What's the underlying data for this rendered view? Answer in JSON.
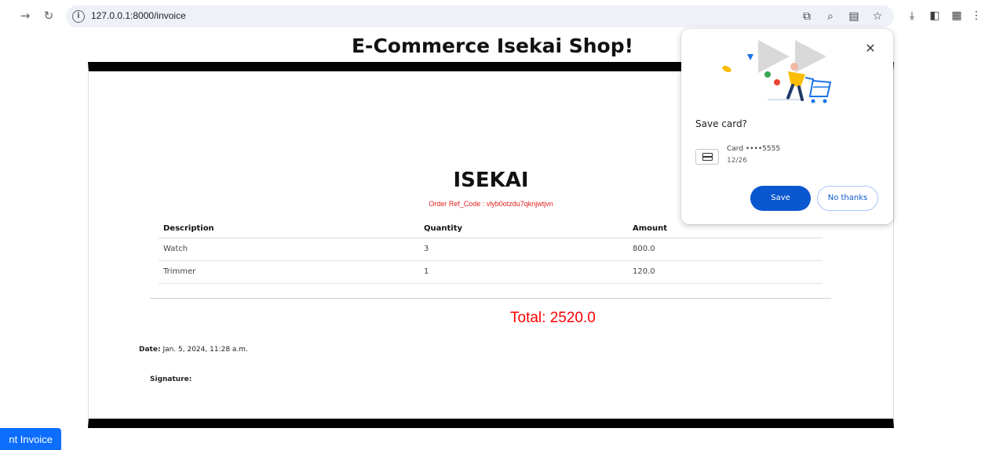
{
  "browser": {
    "url": "127.0.0.1:8000/invoice",
    "icons": [
      "back-arrow-icon",
      "reload-icon",
      "info-icon",
      "open-in-icon",
      "zoom-icon",
      "card-icon",
      "star-icon",
      "download-icon",
      "sidebar-icon",
      "extension-icon",
      "menu-icon"
    ]
  },
  "page": {
    "shop_title": "E-Commerce Isekai Shop!",
    "brand": "ISEKAI",
    "order_ref": "Order Ref_Code : vlyb0otzdu7qknjwtjvn",
    "table": {
      "headers": [
        "Description",
        "Quantity",
        "Amount"
      ],
      "rows": [
        [
          "Watch",
          "3",
          "800.0"
        ],
        [
          "Trimmer",
          "1",
          "120.0"
        ]
      ]
    },
    "total": "Total: 2520.0",
    "date_label": "Date:",
    "date_value": "Jan. 5, 2024, 11:28 a.m.",
    "signature_label": "Signature:",
    "print_button": "nt Invoice"
  },
  "popup": {
    "title": "Save card?",
    "card_label": "Card ••••5555",
    "card_expiry": "12/26",
    "save_button": "Save",
    "no_thanks_button": "No thanks",
    "close_glyph": "✕"
  },
  "colors": {
    "accent_blue": "#0b57d0",
    "print_button_blue": "#0d6efd",
    "total_red": "#ff0000",
    "ref_red": "#e02020",
    "border_black": "#000000"
  }
}
